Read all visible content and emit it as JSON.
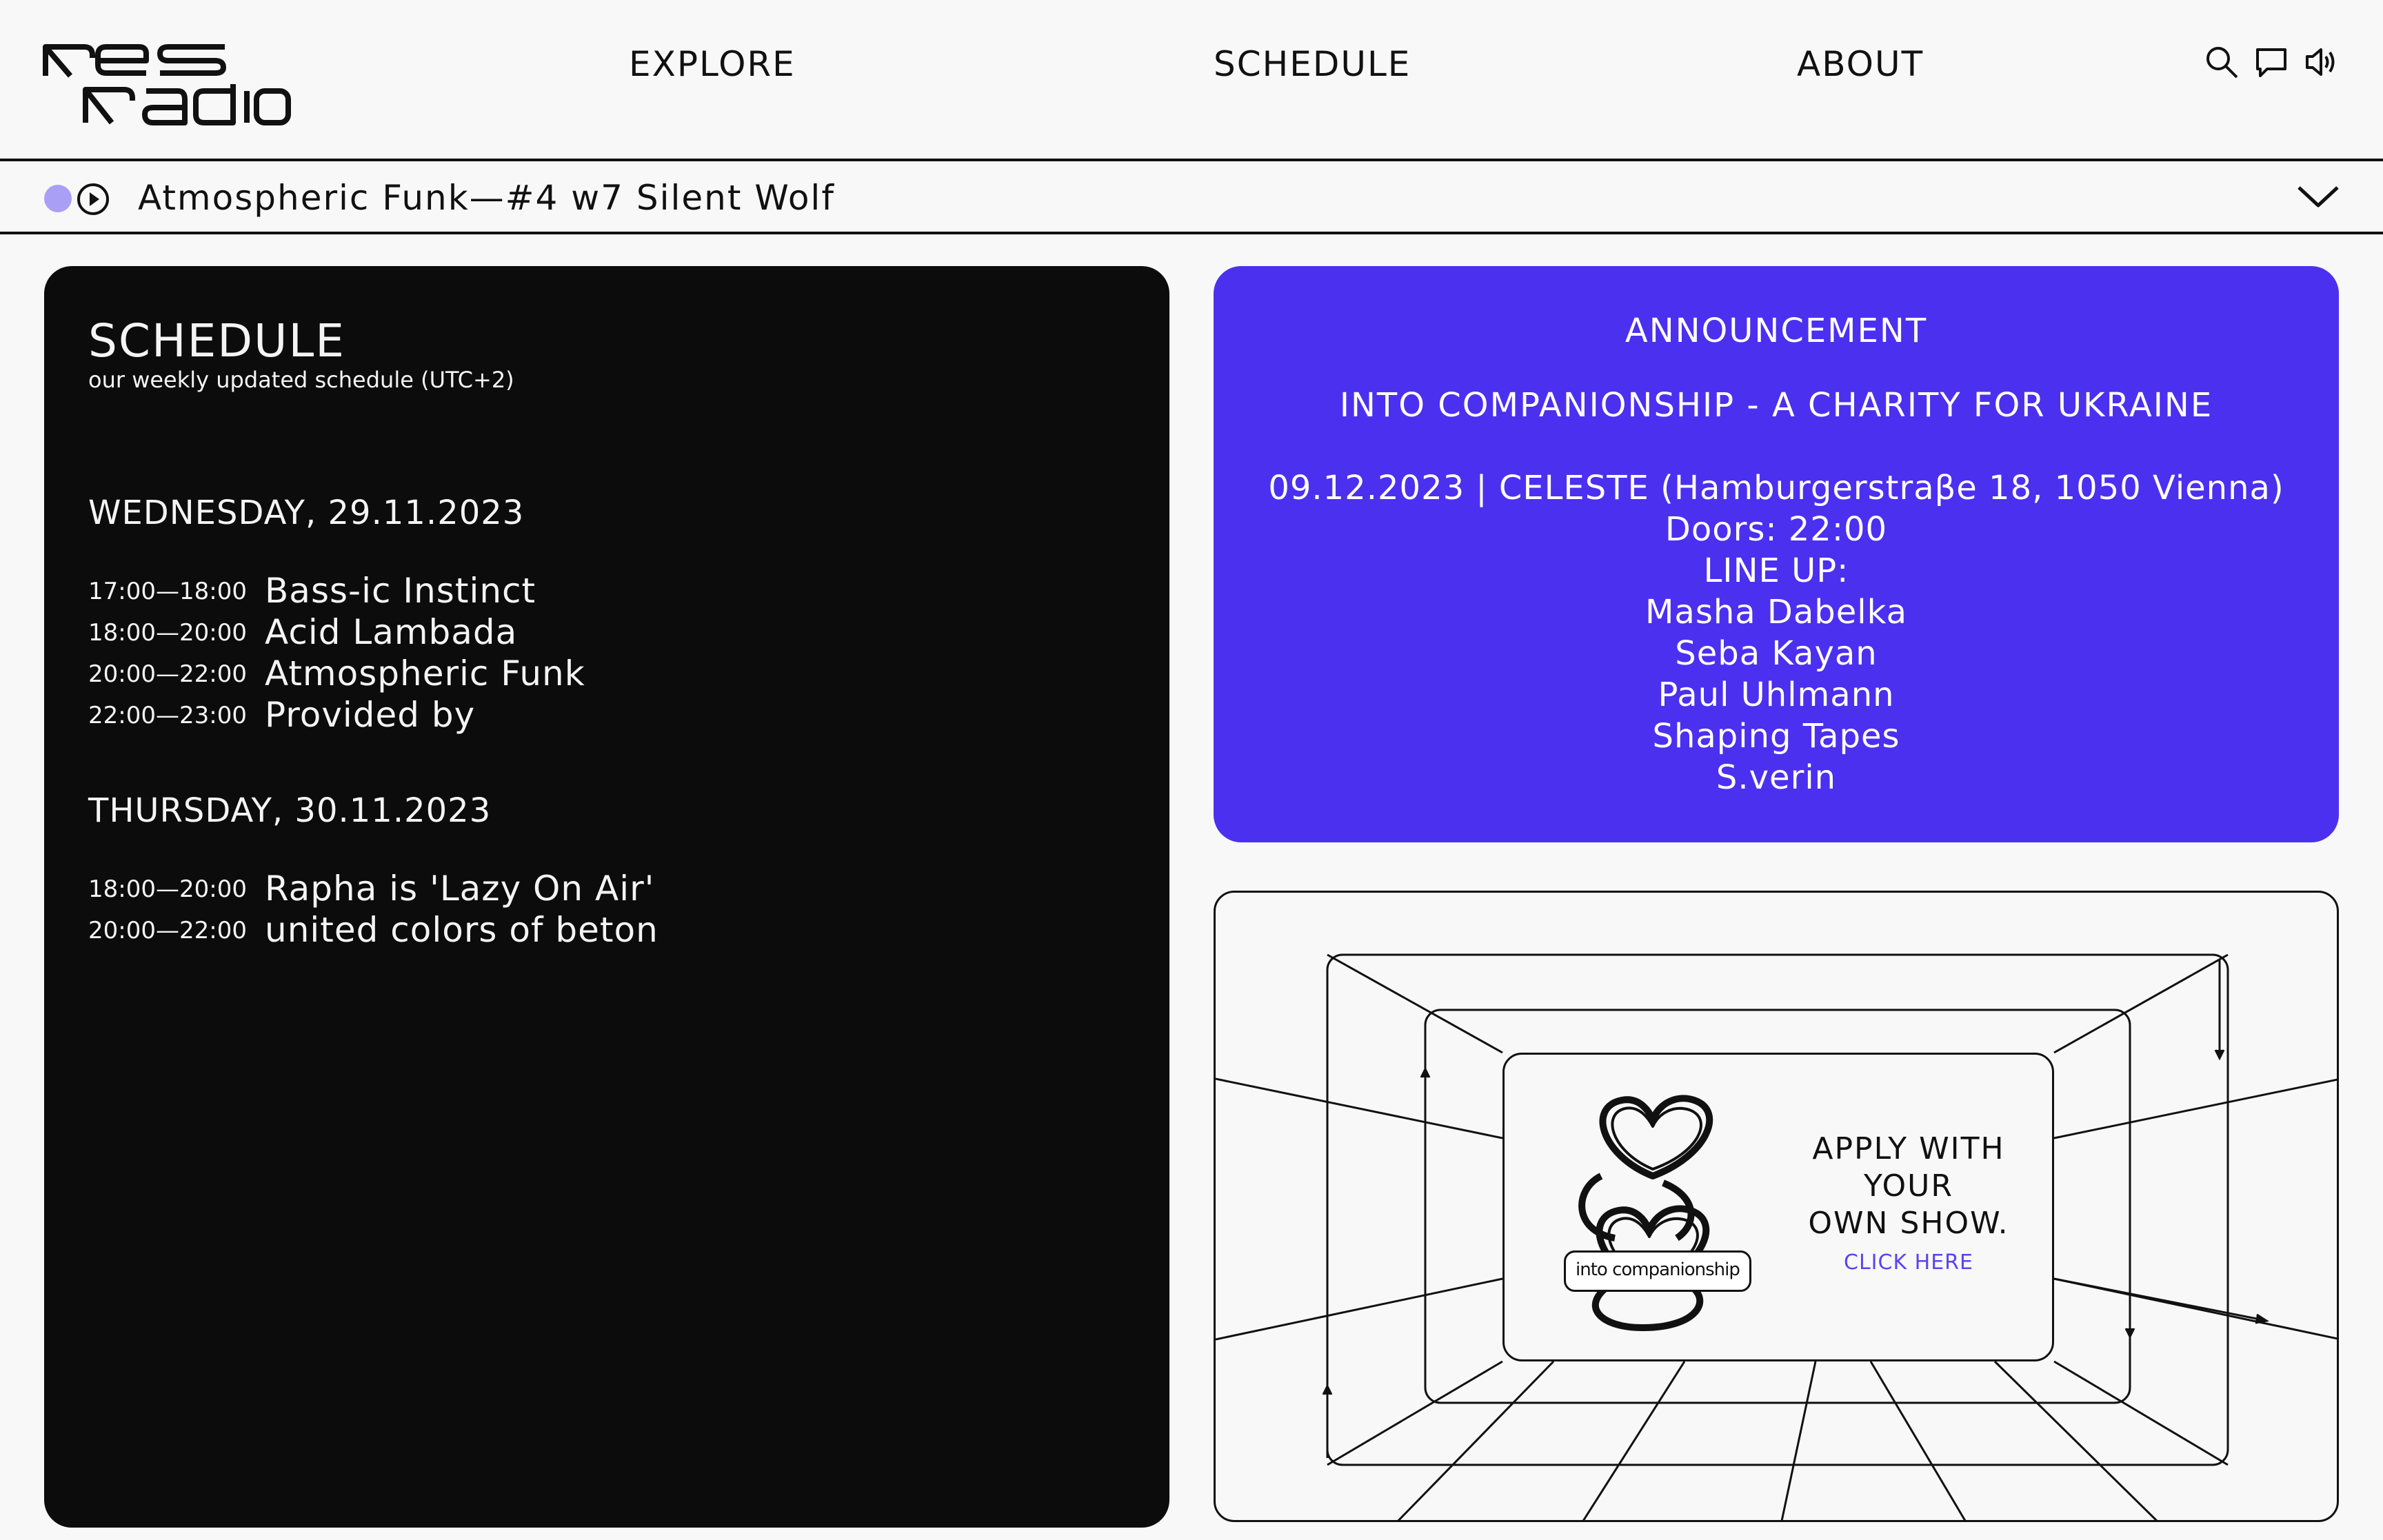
{
  "header": {
    "logo_text": "res radio",
    "nav": {
      "explore": "EXPLORE",
      "schedule": "SCHEDULE",
      "about": "ABOUT"
    },
    "icons": [
      "search-icon",
      "chat-icon",
      "speaker-icon"
    ]
  },
  "player": {
    "now_playing": "Atmospheric Funk—#4 w7 Silent Wolf",
    "live_color": "#a9a0f5"
  },
  "schedule": {
    "title": "SCHEDULE",
    "subtitle": "our weekly updated schedule (UTC+2)",
    "days": [
      {
        "label": "WEDNESDAY, 29.11.2023",
        "slots": [
          {
            "time": "17:00—18:00",
            "show": "Bass-ic Instinct"
          },
          {
            "time": "18:00—20:00",
            "show": "Acid Lambada"
          },
          {
            "time": "20:00—22:00",
            "show": "Atmospheric Funk"
          },
          {
            "time": "22:00—23:00",
            "show": "Provided by"
          }
        ]
      },
      {
        "label": "THURSDAY, 30.11.2023",
        "slots": [
          {
            "time": "18:00—20:00",
            "show": "Rapha is 'Lazy On Air'"
          },
          {
            "time": "20:00—22:00",
            "show": "united colors of beton"
          }
        ]
      }
    ]
  },
  "announcement": {
    "label": "ANNOUNCEMENT",
    "title": "INTO COMPANIONSHIP - A CHARITY FOR UKRAINE",
    "details": "09.12.2023 | CELESTE (Hamburgerstraβe 18, 1050 Vienna)",
    "doors": "Doors: 22:00",
    "lineup_label": "LINE UP:",
    "lineup": [
      "Masha Dabelka",
      "Seba Kayan",
      "Paul Uhlmann",
      "Shaping Tapes",
      "S.verin"
    ],
    "bg_color": "#4b30f0"
  },
  "apply": {
    "line1": "APPLY WITH",
    "line2": "YOUR",
    "line3": "OWN SHOW.",
    "cta": "CLICK HERE",
    "badge": "into companionship",
    "cta_color": "#5a43f0"
  }
}
